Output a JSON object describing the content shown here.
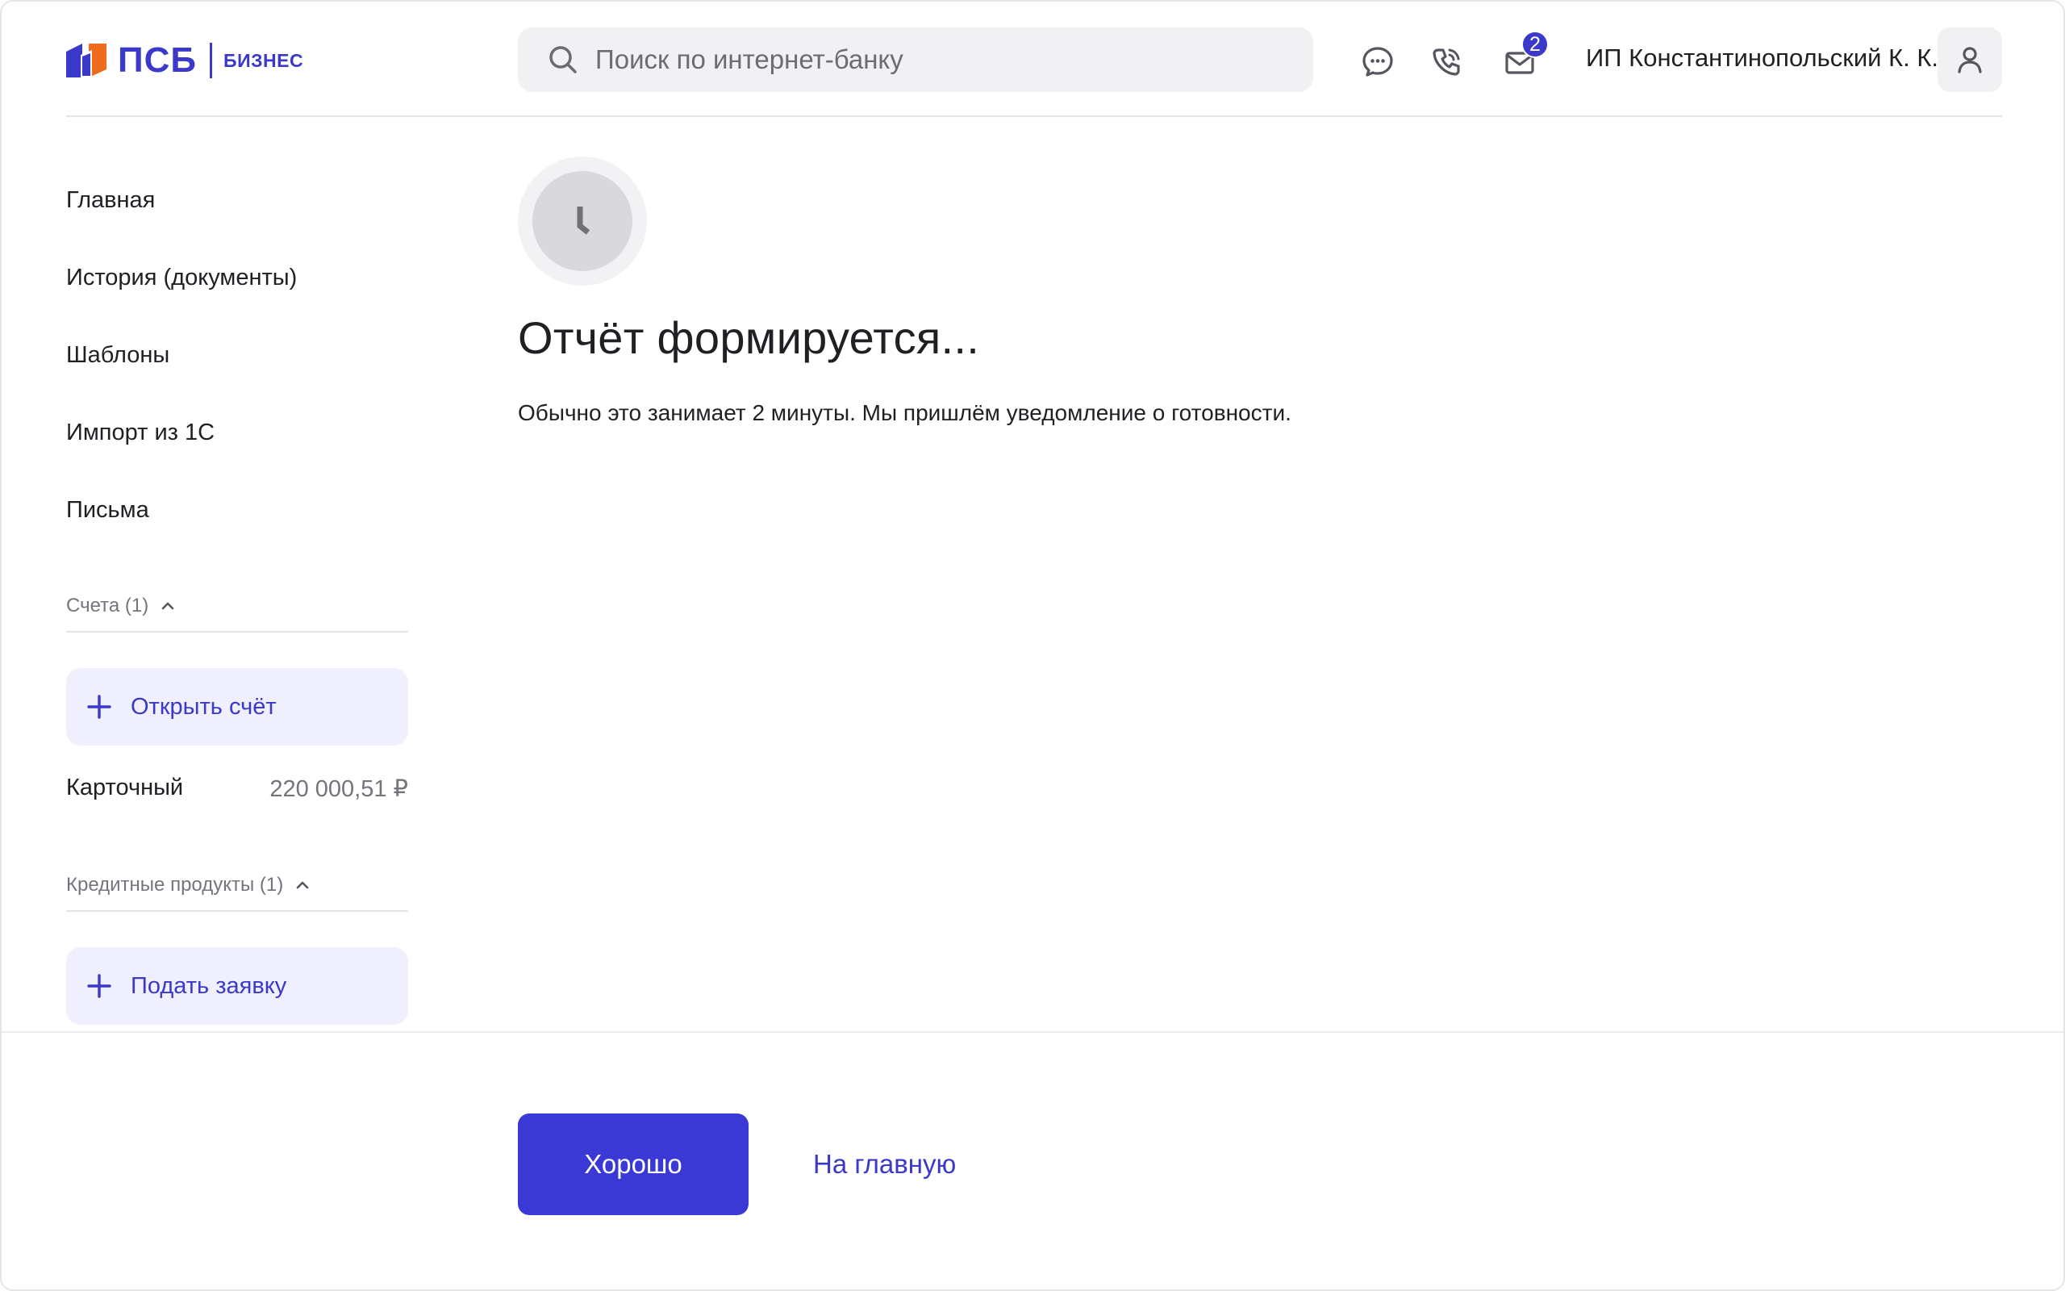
{
  "brand": {
    "name": "ПСБ",
    "subtitle": "БИЗНЕС",
    "colors": {
      "primary": "#3a39c9",
      "accent": "#ef6c1e"
    }
  },
  "header": {
    "search_placeholder": "Поиск по интернет-банку",
    "icons": [
      "chat-icon",
      "phone-icon",
      "mail-icon"
    ],
    "notification_count": "2",
    "user_name": "ИП Константинопольский К. К."
  },
  "sidebar": {
    "nav": [
      {
        "label": "Главная"
      },
      {
        "label": "История (документы)"
      },
      {
        "label": "Шаблоны"
      },
      {
        "label": "Импорт из 1С"
      },
      {
        "label": "Письма"
      }
    ],
    "accounts": {
      "header": "Счета (1)",
      "open_label": "Открыть счёт",
      "items": [
        {
          "name": "Карточный",
          "amount": "220 000,51 ₽"
        }
      ]
    },
    "credit": {
      "header": "Кредитные продукты (1)",
      "apply_label": "Подать заявку"
    }
  },
  "main": {
    "status_icon": "clock-icon",
    "title": "Отчёт формируется...",
    "description": "Обычно это занимает 2 минуты. Мы пришлём уведомление о готовности."
  },
  "footer": {
    "ok_label": "Хорошо",
    "home_label": "На главную"
  }
}
